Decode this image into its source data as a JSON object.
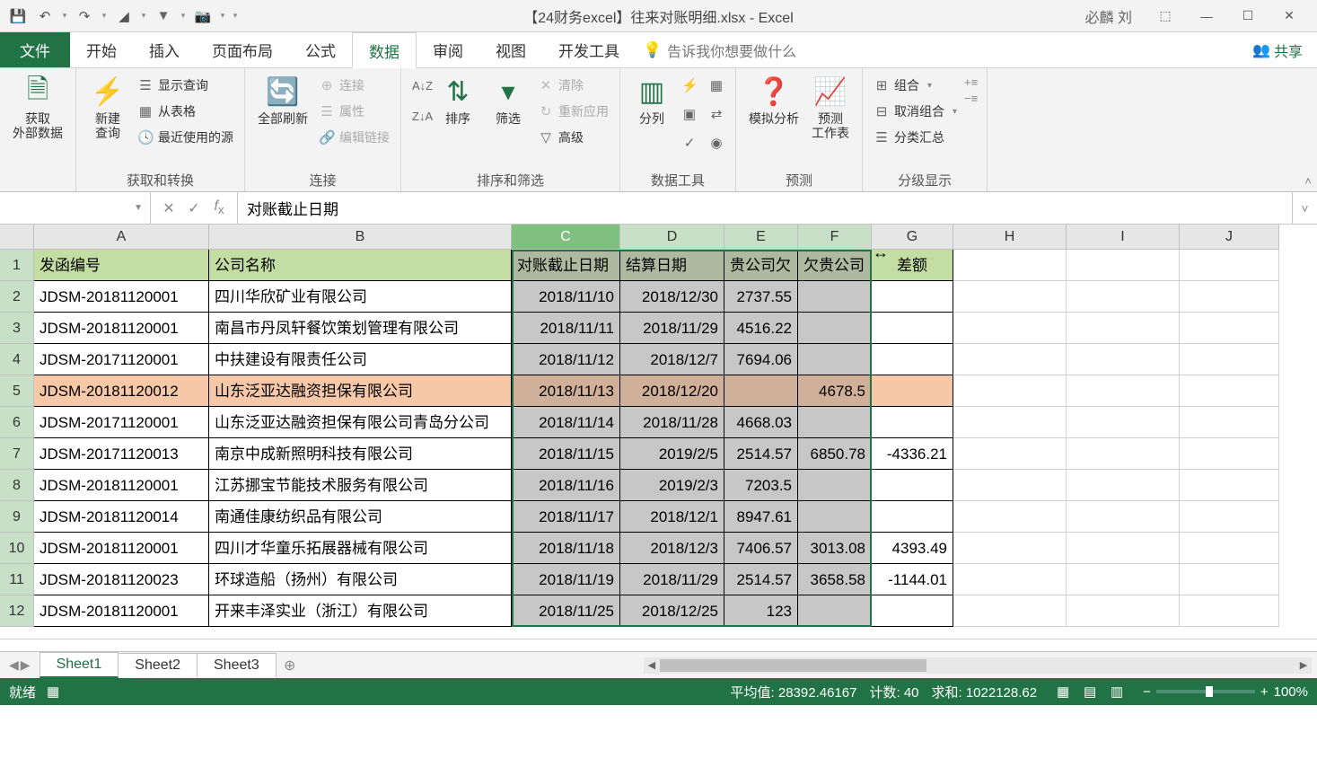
{
  "title": "【24财务excel】往来对账明细.xlsx  -  Excel",
  "user": "必麟 刘",
  "tabs": {
    "file": "文件",
    "home": "开始",
    "insert": "插入",
    "layout": "页面布局",
    "formula": "公式",
    "data": "数据",
    "review": "审阅",
    "view": "视图",
    "dev": "开发工具",
    "tellme": "告诉我你想要做什么",
    "share": "共享"
  },
  "ribbon": {
    "g1": {
      "btn": "获取\n外部数据",
      "label": ""
    },
    "g2": {
      "big": "新建\n查询",
      "s1": "显示查询",
      "s2": "从表格",
      "s3": "最近使用的源",
      "label": "获取和转换"
    },
    "g3": {
      "big": "全部刷新",
      "s1": "连接",
      "s2": "属性",
      "s3": "编辑链接",
      "label": "连接"
    },
    "g4": {
      "sort": "排序",
      "filter": "筛选",
      "s1": "清除",
      "s2": "重新应用",
      "s3": "高级",
      "label": "排序和筛选"
    },
    "g5": {
      "big": "分列",
      "label": "数据工具"
    },
    "g6": {
      "b1": "模拟分析",
      "b2": "预测\n工作表",
      "label": "预测"
    },
    "g7": {
      "s1": "组合",
      "s2": "取消组合",
      "s3": "分类汇总",
      "label": "分级显示"
    }
  },
  "namebox": "",
  "formula": "对账截止日期",
  "cols": [
    "A",
    "B",
    "C",
    "D",
    "E",
    "F",
    "G",
    "H",
    "I",
    "J"
  ],
  "headers": {
    "A": "发函编号",
    "B": "公司名称",
    "C": "对账截止日期",
    "D": "结算日期",
    "E": "贵公司欠",
    "F": "欠贵公司",
    "G": "差额"
  },
  "rows": [
    {
      "n": 2,
      "A": "JDSM-20181120001",
      "B": "四川华欣矿业有限公司",
      "C": "2018/11/10",
      "D": "2018/12/30",
      "E": "2737.55",
      "F": "",
      "G": ""
    },
    {
      "n": 3,
      "A": "JDSM-20181120001",
      "B": "南昌市丹凤轩餐饮策划管理有限公司",
      "C": "2018/11/11",
      "D": "2018/11/29",
      "E": "4516.22",
      "F": "",
      "G": ""
    },
    {
      "n": 4,
      "A": "JDSM-20171120001",
      "B": "中扶建设有限责任公司",
      "C": "2018/11/12",
      "D": "2018/12/7",
      "E": "7694.06",
      "F": "",
      "G": ""
    },
    {
      "n": 5,
      "A": "JDSM-20181120012",
      "B": "山东泛亚达融资担保有限公司",
      "C": "2018/11/13",
      "D": "2018/12/20",
      "E": "",
      "F": "4678.5",
      "G": "",
      "hl": true
    },
    {
      "n": 6,
      "A": "JDSM-20171120001",
      "B": "山东泛亚达融资担保有限公司青岛分公司",
      "C": "2018/11/14",
      "D": "2018/11/28",
      "E": "4668.03",
      "F": "",
      "G": ""
    },
    {
      "n": 7,
      "A": "JDSM-20171120013",
      "B": "南京中成新照明科技有限公司",
      "C": "2018/11/15",
      "D": "2019/2/5",
      "E": "2514.57",
      "F": "6850.78",
      "G": "-4336.21"
    },
    {
      "n": 8,
      "A": "JDSM-20181120001",
      "B": "江苏挪宝节能技术服务有限公司",
      "C": "2018/11/16",
      "D": "2019/2/3",
      "E": "7203.5",
      "F": "",
      "G": ""
    },
    {
      "n": 9,
      "A": "JDSM-20181120014",
      "B": "南通佳康纺织品有限公司",
      "C": "2018/11/17",
      "D": "2018/12/1",
      "E": "8947.61",
      "F": "",
      "G": ""
    },
    {
      "n": 10,
      "A": "JDSM-20181120001",
      "B": "四川才华童乐拓展器械有限公司",
      "C": "2018/11/18",
      "D": "2018/12/3",
      "E": "7406.57",
      "F": "3013.08",
      "G": "4393.49"
    },
    {
      "n": 11,
      "A": "JDSM-20181120023",
      "B": "环球造船（扬州）有限公司",
      "C": "2018/11/19",
      "D": "2018/11/29",
      "E": "2514.57",
      "F": "3658.58",
      "G": "-1144.01"
    },
    {
      "n": 12,
      "A": "JDSM-20181120001",
      "B": "开来丰泽实业（浙江）有限公司",
      "C": "2018/11/25",
      "D": "2018/12/25",
      "E": "123",
      "F": "",
      "G": ""
    }
  ],
  "sheets": [
    "Sheet1",
    "Sheet2",
    "Sheet3"
  ],
  "status": {
    "ready": "就绪",
    "avg_l": "平均值:",
    "avg": "28392.46167",
    "cnt_l": "计数:",
    "cnt": "40",
    "sum_l": "求和:",
    "sum": "1022128.62",
    "zoom": "100%"
  }
}
